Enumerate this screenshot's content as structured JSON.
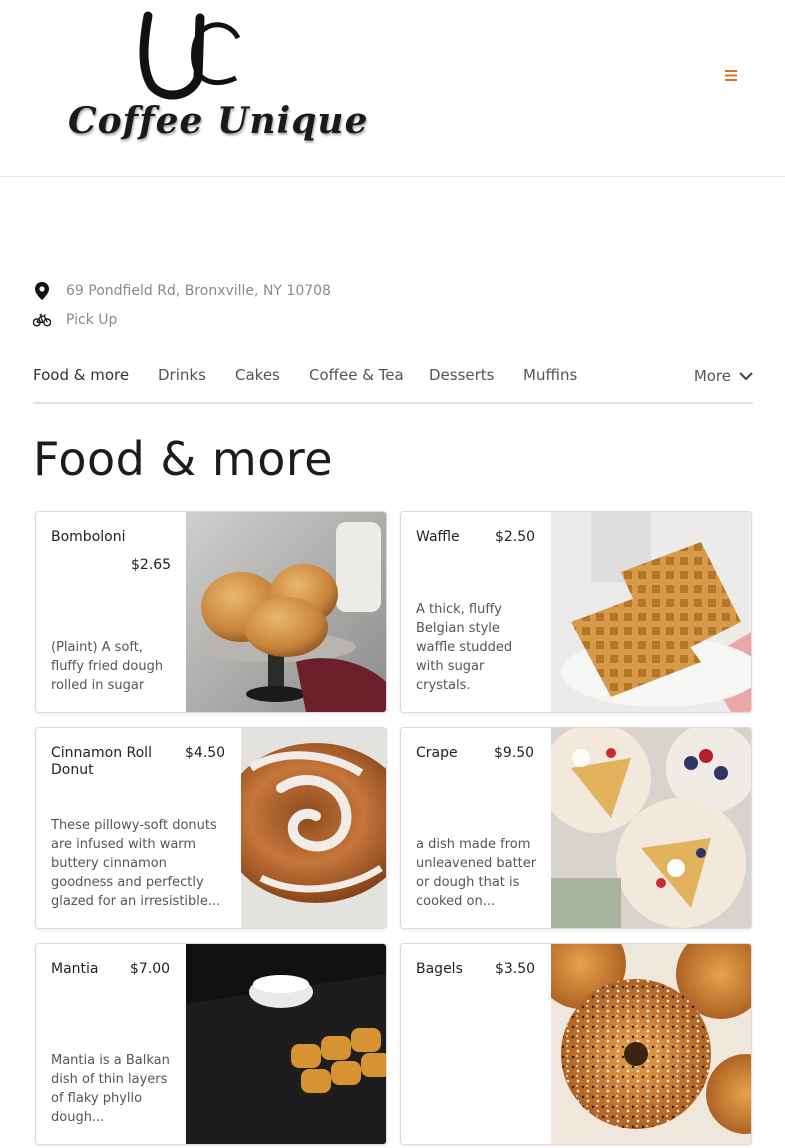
{
  "header": {
    "logo_text": "Coffee Unique",
    "menu_icon": "hamburger-icon"
  },
  "info": {
    "address": "69 Pondfield Rd, Bronxville, NY 10708",
    "address_icon": "map-pin-icon",
    "mode": "Pick Up",
    "mode_icon": "bicycle-icon"
  },
  "tabs": {
    "items": [
      "Food & more",
      "Drinks",
      "Cakes",
      "Coffee & Tea",
      "Desserts",
      "Muffins"
    ],
    "more_label": "More",
    "active": "Food & more"
  },
  "section": {
    "title": "Food & more"
  },
  "products": [
    {
      "name": "Bomboloni",
      "price": "$2.65",
      "desc": "(Plaint) A soft, fluffy fried dough rolled in sugar"
    },
    {
      "name": "Waffle",
      "price": "$2.50",
      "desc": "A thick, fluffy Belgian style waffle studded with sugar crystals."
    },
    {
      "name": "Cinnamon Roll Donut",
      "price": "$4.50",
      "desc": "These pillowy-soft donuts are infused with warm buttery cinnamon goodness and perfectly glazed for an irresistible..."
    },
    {
      "name": "Crape",
      "price": "$9.50",
      "desc": "a dish made from unleavened batter or dough that is cooked on..."
    },
    {
      "name": "Mantia",
      "price": "$7.00",
      "desc": "Mantia is a Balkan dish of thin layers of flaky phyllo dough..."
    },
    {
      "name": "Bagels",
      "price": "$3.50",
      "desc": ""
    }
  ],
  "colors": {
    "accent": "#e07020"
  }
}
